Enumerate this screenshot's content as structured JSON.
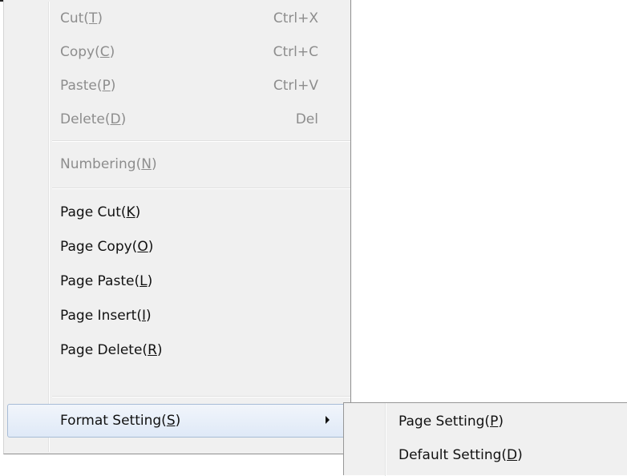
{
  "menu": {
    "items": [
      {
        "pre": "Cut(",
        "key": "T",
        "post": ")",
        "shortcut": "Ctrl+X",
        "enabled": false
      },
      {
        "pre": "Copy(",
        "key": "C",
        "post": ")",
        "shortcut": "Ctrl+C",
        "enabled": false
      },
      {
        "pre": "Paste(",
        "key": "P",
        "post": ")",
        "shortcut": "Ctrl+V",
        "enabled": false
      },
      {
        "pre": "Delete(",
        "key": "D",
        "post": ")",
        "shortcut": "Del",
        "enabled": false
      },
      {
        "pre": "Numbering(",
        "key": "N",
        "post": ")",
        "shortcut": "",
        "enabled": false
      },
      {
        "pre": "Page Cut(",
        "key": "K",
        "post": ")",
        "shortcut": "",
        "enabled": true
      },
      {
        "pre": "Page Copy(",
        "key": "O",
        "post": ")",
        "shortcut": "",
        "enabled": true
      },
      {
        "pre": "Page Paste(",
        "key": "L",
        "post": ")",
        "shortcut": "",
        "enabled": true
      },
      {
        "pre": "Page Insert(",
        "key": "I",
        "post": ")",
        "shortcut": "",
        "enabled": true
      },
      {
        "pre": "Page Delete(",
        "key": "R",
        "post": ")",
        "shortcut": "",
        "enabled": true
      },
      {
        "pre": "Format Setting(",
        "key": "S",
        "post": ")",
        "shortcut": "",
        "enabled": true,
        "highlighted": true,
        "has_submenu": true
      }
    ]
  },
  "submenu": {
    "items": [
      {
        "pre": "Page Setting(",
        "key": "P",
        "post": ")"
      },
      {
        "pre": "Default Setting(",
        "key": "D",
        "post": ")"
      }
    ]
  },
  "colors": {
    "menu_bg": "#f0f0f0",
    "disabled_text": "#8d8d8d",
    "enabled_text": "#111111",
    "highlight_border": "#a7bcd6"
  }
}
